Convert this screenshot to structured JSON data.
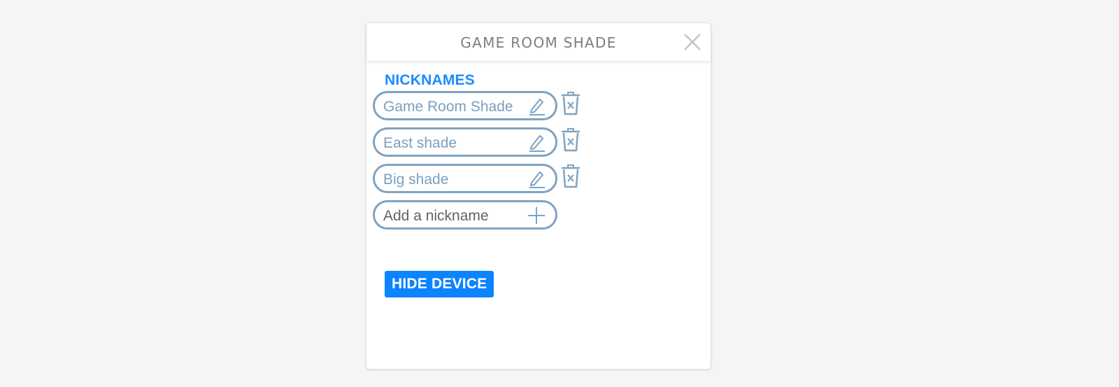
{
  "modal": {
    "title": "GAME ROOM SHADE",
    "close_icon": "close-icon"
  },
  "nicknames": {
    "label": "NICKNAMES",
    "items": [
      {
        "value": "Game Room Shade",
        "edit_icon": "pencil-icon",
        "delete_icon": "trash-icon"
      },
      {
        "value": "East shade",
        "edit_icon": "pencil-icon",
        "delete_icon": "trash-icon"
      },
      {
        "value": "Big shade",
        "edit_icon": "pencil-icon",
        "delete_icon": "trash-icon"
      }
    ],
    "add": {
      "placeholder": "Add a nickname",
      "icon": "plus-icon"
    }
  },
  "actions": {
    "hide_device_label": "HIDE DEVICE"
  },
  "colors": {
    "accent": "#1a8cff",
    "button": "#0a84ff",
    "pill_border": "#7fa3c2",
    "pill_text": "#7a9fc0"
  }
}
